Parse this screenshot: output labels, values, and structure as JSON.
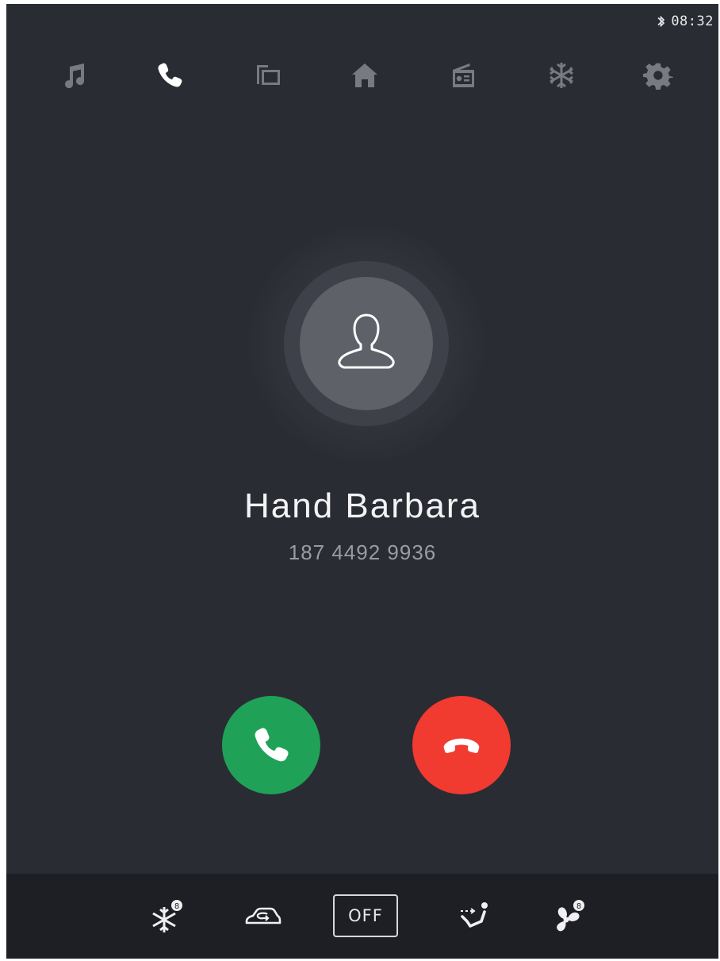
{
  "status_bar": {
    "time": "08:32",
    "bluetooth_icon": "bluetooth-icon"
  },
  "top_nav": {
    "items": [
      {
        "name": "music",
        "icon": "music-note-icon",
        "active": false
      },
      {
        "name": "phone",
        "icon": "phone-icon",
        "active": true
      },
      {
        "name": "screen-mirroring",
        "icon": "screen-mirror-icon",
        "active": false
      },
      {
        "name": "home",
        "icon": "home-icon",
        "active": false
      },
      {
        "name": "radio",
        "icon": "radio-icon",
        "active": false
      },
      {
        "name": "climate",
        "icon": "snowflake-icon",
        "active": false
      },
      {
        "name": "settings",
        "icon": "gear-icon",
        "active": false
      }
    ],
    "active_color": "#ffffff",
    "inactive_color": "#777a82"
  },
  "call": {
    "caller_name": "Hand Barbara",
    "caller_number": "187 4492 9936",
    "avatar_icon": "person-outline-icon",
    "accept_icon": "phone-accept-icon",
    "decline_icon": "phone-hangup-icon",
    "accept_color": "#20a158",
    "decline_color": "#f13a30"
  },
  "climate_bar": {
    "off_label": "OFF",
    "items": [
      {
        "icon": "ac-snowflake-icon"
      },
      {
        "icon": "air-recirculation-icon"
      },
      {
        "icon": "airflow-direction-icon"
      },
      {
        "icon": "fan-speed-icon"
      }
    ]
  },
  "colors": {
    "background": "#2a2c33",
    "bottom_bar": "#1e1f24"
  }
}
